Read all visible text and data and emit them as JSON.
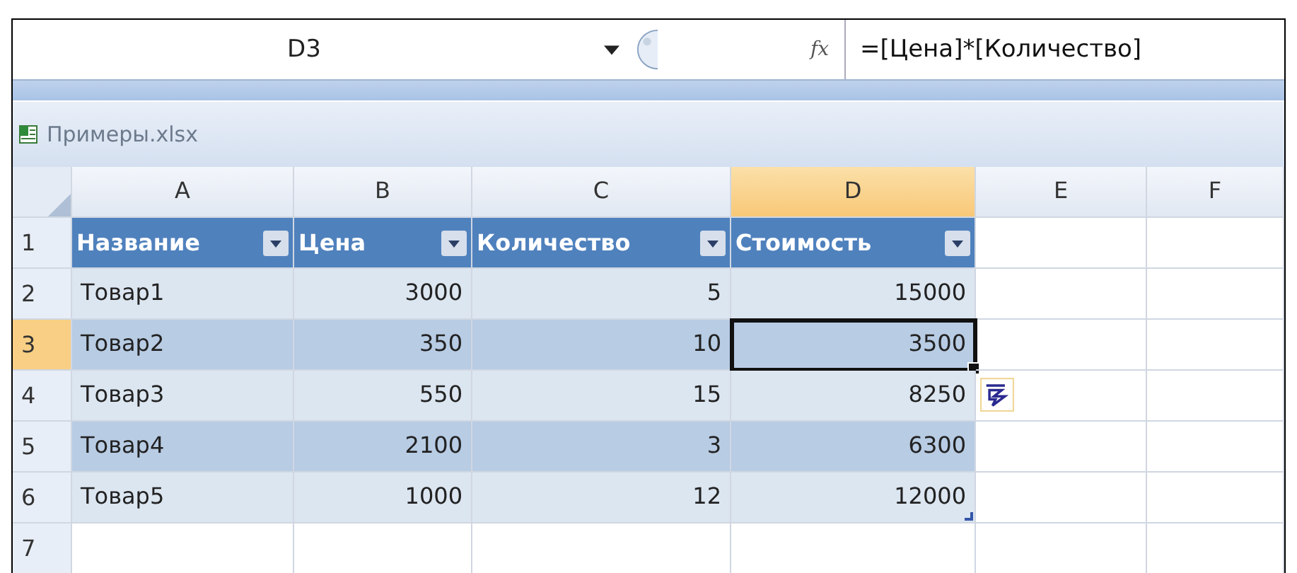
{
  "formula_bar": {
    "name_box": "D3",
    "function_label": "fx",
    "formula": "=[Цена]*[Количество]"
  },
  "workbook": {
    "title": "Примеры.xlsx"
  },
  "columns": [
    {
      "label": "A",
      "selected": false
    },
    {
      "label": "B",
      "selected": false
    },
    {
      "label": "C",
      "selected": false
    },
    {
      "label": "D",
      "selected": true
    },
    {
      "label": "E",
      "selected": false
    },
    {
      "label": "F",
      "selected": false
    }
  ],
  "table_headers": [
    "Название",
    "Цена",
    "Количество",
    "Стоимость"
  ],
  "rows": [
    {
      "number": "1",
      "selected": false,
      "kind": "header"
    },
    {
      "number": "2",
      "selected": false,
      "kind": "data",
      "cells": [
        {
          "text": "Товар1",
          "active": false
        },
        {
          "text": "3000",
          "active": false
        },
        {
          "text": "5",
          "active": false
        },
        {
          "text": "15000",
          "active": false
        }
      ]
    },
    {
      "number": "3",
      "selected": true,
      "kind": "data",
      "cells": [
        {
          "text": "Товар2",
          "active": false
        },
        {
          "text": "350",
          "active": false
        },
        {
          "text": "10",
          "active": false
        },
        {
          "text": "3500",
          "active": true
        }
      ]
    },
    {
      "number": "4",
      "selected": false,
      "kind": "data",
      "smart_tag": true,
      "cells": [
        {
          "text": "Товар3",
          "active": false
        },
        {
          "text": "550",
          "active": false
        },
        {
          "text": "15",
          "active": false
        },
        {
          "text": "8250",
          "active": false
        }
      ]
    },
    {
      "number": "5",
      "selected": false,
      "kind": "data",
      "cells": [
        {
          "text": "Товар4",
          "active": false
        },
        {
          "text": "2100",
          "active": false
        },
        {
          "text": "3",
          "active": false
        },
        {
          "text": "6300",
          "active": false
        }
      ]
    },
    {
      "number": "6",
      "selected": false,
      "kind": "data",
      "cells": [
        {
          "text": "Товар5",
          "active": false
        },
        {
          "text": "1000",
          "active": false
        },
        {
          "text": "12",
          "active": false
        },
        {
          "text": "12000",
          "active": false
        }
      ]
    },
    {
      "number": "7",
      "selected": false,
      "kind": "empty"
    }
  ]
}
